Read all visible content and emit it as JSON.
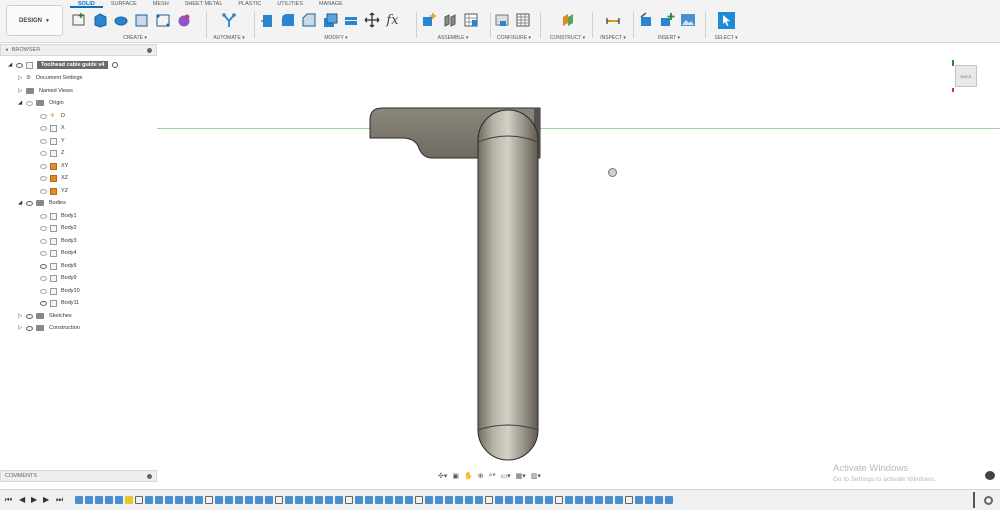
{
  "toolbar": {
    "workspace": "DESIGN",
    "tabs": [
      "SOLID",
      "SURFACE",
      "MESH",
      "SHEET METAL",
      "PLASTIC",
      "UTILITIES",
      "MANAGE"
    ],
    "groups": {
      "create": "CREATE",
      "automate": "AUTOMATE",
      "modify": "MODIFY",
      "assemble": "ASSEMBLE",
      "configure": "CONFIGURE",
      "construct": "CONSTRUCT",
      "inspect": "INSPECT",
      "insert": "INSERT",
      "select": "SELECT"
    },
    "fx_glyph": "fx"
  },
  "browser": {
    "title": "BROWSER",
    "root": "Toolhead cable guide v4",
    "document_settings": "Document Settings",
    "named_views": "Named Views",
    "origin": "Origin",
    "origin_items": [
      "O",
      "X",
      "Y",
      "Z",
      "XY",
      "XZ",
      "YZ"
    ],
    "bodies": "Bodies",
    "body_items": [
      "Body1",
      "Body2",
      "Body3",
      "Body4",
      "Body5",
      "Body9",
      "Body10",
      "Body11"
    ],
    "sketches": "Sketches",
    "construction": "Construction"
  },
  "comments": {
    "title": "COMMENTS"
  },
  "watermark": {
    "line1": "Activate Windows",
    "line2": "Go to Settings to activate Windows."
  },
  "viewcube": {
    "face": "BACK"
  },
  "colors": {
    "accent": "#0b6fc0",
    "select_blue": "#1f8ad6",
    "body_metal": "#8f8a7f",
    "grid": "#dcdcdc",
    "timeline_item": "#4a8fd0",
    "timeline_selected": "#e3c82a"
  },
  "timeline_count": 60,
  "timeline_selected_index": 5
}
